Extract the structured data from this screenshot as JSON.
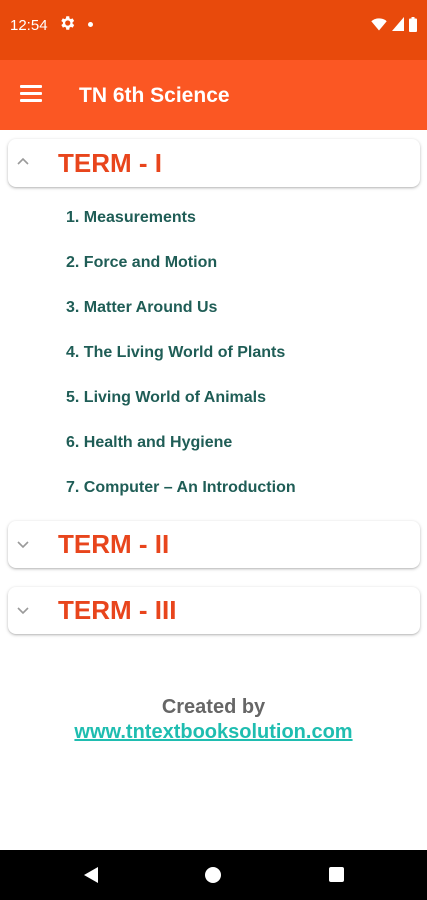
{
  "status_bar": {
    "time": "12:54"
  },
  "app_bar": {
    "title": "TN 6th Science"
  },
  "terms": [
    {
      "title": "TERM - I",
      "expanded": true,
      "chapters": [
        "1. Measurements",
        "2. Force and Motion",
        "3. Matter Around Us",
        "4. The Living World of Plants",
        "5. Living World of Animals",
        "6. Health and Hygiene",
        "7. Computer – An Introduction"
      ]
    },
    {
      "title": "TERM - II",
      "expanded": false
    },
    {
      "title": "TERM - III",
      "expanded": false
    }
  ],
  "footer": {
    "created_by": "Created by",
    "website": "www.tntextbooksolution.com"
  },
  "colors": {
    "status_bar": "#e84a0c",
    "app_bar": "#fb5723",
    "term_title": "#e8451c",
    "chapter_text": "#1f5d56",
    "link": "#1fbdb0"
  }
}
